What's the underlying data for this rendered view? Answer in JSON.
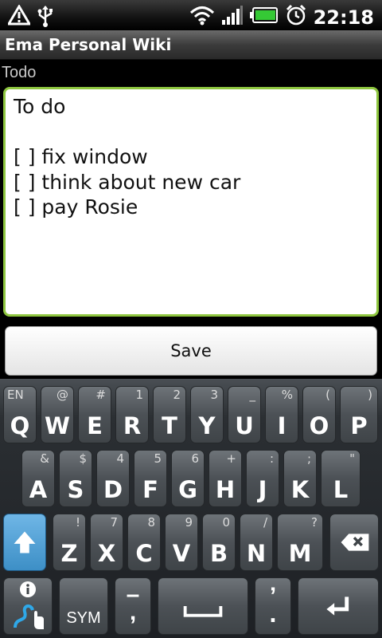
{
  "status_bar": {
    "time": "22:18",
    "icons": [
      "warning-icon",
      "usb-icon",
      "wifi-icon",
      "signal-icon",
      "battery-icon",
      "alarm-icon"
    ]
  },
  "app": {
    "title": "Ema Personal Wiki"
  },
  "page": {
    "name": "Todo",
    "content": "To do\n\n[ ] fix window\n[ ] think about new car\n[ ] pay Rosie",
    "save_label": "Save"
  },
  "keyboard": {
    "row1": [
      {
        "main": "Q",
        "alt": "EN"
      },
      {
        "main": "W",
        "alt": "@"
      },
      {
        "main": "E",
        "alt": "#"
      },
      {
        "main": "R",
        "alt": "1"
      },
      {
        "main": "T",
        "alt": "2"
      },
      {
        "main": "Y",
        "alt": "3"
      },
      {
        "main": "U",
        "alt": "_"
      },
      {
        "main": "I",
        "alt": "%"
      },
      {
        "main": "O",
        "alt": "("
      },
      {
        "main": "P",
        "alt": ")"
      }
    ],
    "row2": [
      {
        "main": "A",
        "alt": "&"
      },
      {
        "main": "S",
        "alt": "$"
      },
      {
        "main": "D",
        "alt": "4"
      },
      {
        "main": "F",
        "alt": "5"
      },
      {
        "main": "G",
        "alt": "6"
      },
      {
        "main": "H",
        "alt": "+"
      },
      {
        "main": "J",
        "alt": ":"
      },
      {
        "main": "K",
        "alt": ";"
      },
      {
        "main": "L",
        "alt": "\""
      }
    ],
    "row3": [
      {
        "main": "Z",
        "alt": "!"
      },
      {
        "main": "X",
        "alt": "7"
      },
      {
        "main": "C",
        "alt": "8"
      },
      {
        "main": "V",
        "alt": "9"
      },
      {
        "main": "B",
        "alt": "0"
      },
      {
        "main": "N",
        "alt": "/"
      },
      {
        "main": "M",
        "alt": "?"
      }
    ],
    "sym_label": "SYM",
    "dash_label": "–",
    "period_label": ".",
    "apostrophe_label": "’",
    "info_label": "i"
  },
  "colors": {
    "editor_border": "#8ec63f",
    "shift_key": "#3d8fc6",
    "keyboard_bg": "#1d2024"
  }
}
